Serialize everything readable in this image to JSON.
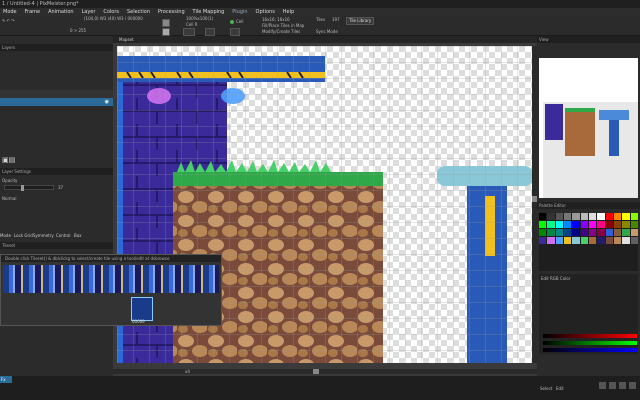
{
  "window": {
    "title": "1 / Untitled-4 | PixMeister.png*"
  },
  "menu": [
    "Mode",
    "Frame",
    "Animation",
    "Layer",
    "Colors",
    "Selection",
    "Processing",
    "Tile Mapping",
    "Plugin",
    "Options",
    "Help"
  ],
  "toolbar": {
    "position": "(104,0) W3 (40) W3 / 000000",
    "range": "0 > 255",
    "zoom": "100%x100(1)",
    "layer_name": "Cell R",
    "alpha": "Cell",
    "grid_btn": "Tile Library",
    "modify_opts": [
      "Modify Selection",
      "Modify/Create Tiles",
      "Sync Mode"
    ],
    "tile_size": "16x16; 16x16",
    "tiles_label": "Tiles",
    "tiles_value": "197",
    "mode_checks": [
      "Fill/Place Tiles in Map",
      "Modify/Create Tiles"
    ]
  },
  "left": {
    "layers_header": "Layers",
    "layer_settings_header": "Layer Settings",
    "opacity_label": "Opacity",
    "opacity_value": "37",
    "blend_label": "Normal",
    "tabs": [
      "Mode",
      "Lock Grid",
      "Symmetry",
      "Control",
      "Box"
    ],
    "tileset_header": "Tileset",
    "tileset_info": "Double click Tileset() & dblclickg to select/create tile using a tool/edit at dsbrowse"
  },
  "canvas": {
    "tab_label": "Mapset",
    "zoom_label": "x4"
  },
  "floating_tile": {
    "index_label": "00009"
  },
  "right": {
    "view_header": "View",
    "palette_header": "Palette Editor",
    "palette_subhdr": "Edit Color on RGB",
    "color_label": "Edit RGB Color",
    "rgb_values": [
      "0",
      "0",
      "0"
    ]
  },
  "status": {
    "badge": "Fx",
    "frame_label": "Select",
    "frame_value": "Edit",
    "palette_index": "0"
  },
  "colors": {
    "accent": "#2a6b9a",
    "panel": "#2b2b2b",
    "header": "#202020",
    "pillar_blue": "#2f5fd8",
    "rock_brown": "#8a5a3a",
    "grass_green": "#2fa84a"
  }
}
